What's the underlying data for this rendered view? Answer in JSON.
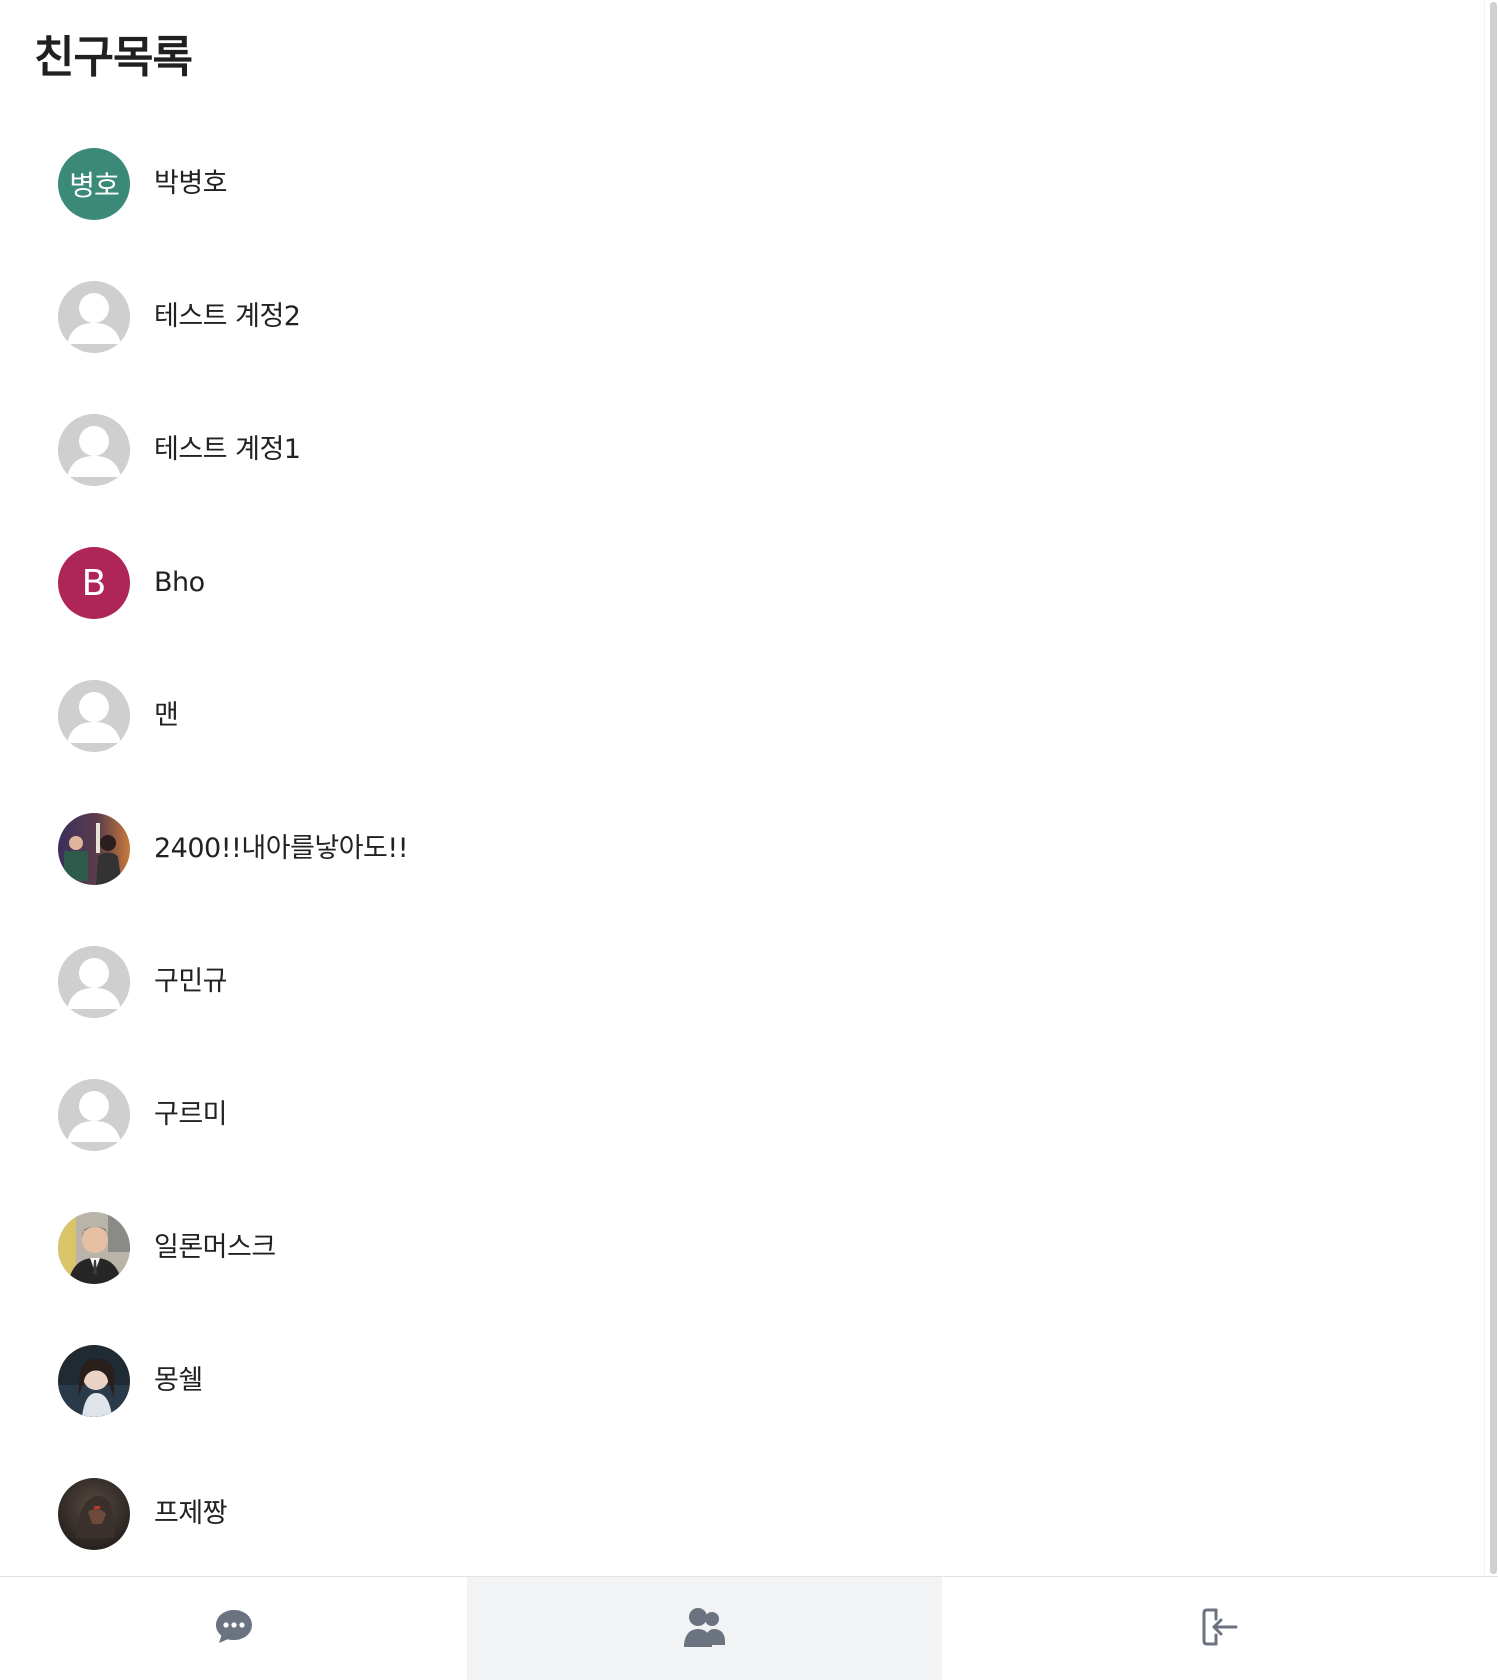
{
  "page": {
    "title": "친구목록"
  },
  "colors": {
    "avatar_teal": "#3b8a77",
    "avatar_magenta": "#ae2558",
    "default_avatar_gray": "#cfcfcf",
    "nav_icon": "#6b7280",
    "nav_active_bg": "#f2f3f5"
  },
  "friends": [
    {
      "name": "박병호",
      "avatar_type": "initials",
      "avatar_text": "병호",
      "avatar_color": "#3b8a77"
    },
    {
      "name": "테스트 계정2",
      "avatar_type": "default",
      "avatar_icon": "default-user-icon"
    },
    {
      "name": "테스트 계정1",
      "avatar_type": "default",
      "avatar_icon": "default-user-icon"
    },
    {
      "name": "Bho",
      "avatar_type": "initials",
      "avatar_text": "B",
      "avatar_color": "#ae2558"
    },
    {
      "name": "맨",
      "avatar_type": "default",
      "avatar_icon": "default-user-icon"
    },
    {
      "name": "2400!!내아를낳아도!!",
      "avatar_type": "photo",
      "avatar_icon": "user-photo"
    },
    {
      "name": "구민규",
      "avatar_type": "default",
      "avatar_icon": "default-user-icon"
    },
    {
      "name": "구르미",
      "avatar_type": "default",
      "avatar_icon": "default-user-icon"
    },
    {
      "name": "일론머스크",
      "avatar_type": "photo",
      "avatar_icon": "user-photo"
    },
    {
      "name": "몽쉘",
      "avatar_type": "photo",
      "avatar_icon": "user-photo"
    },
    {
      "name": "프제짱",
      "avatar_type": "photo",
      "avatar_icon": "user-photo"
    }
  ],
  "bottom_nav": {
    "tabs": [
      {
        "id": "chats",
        "icon": "chat-bubble-icon",
        "active": false
      },
      {
        "id": "friends",
        "icon": "users-icon",
        "active": true
      },
      {
        "id": "logout",
        "icon": "logout-icon",
        "active": false
      }
    ]
  }
}
